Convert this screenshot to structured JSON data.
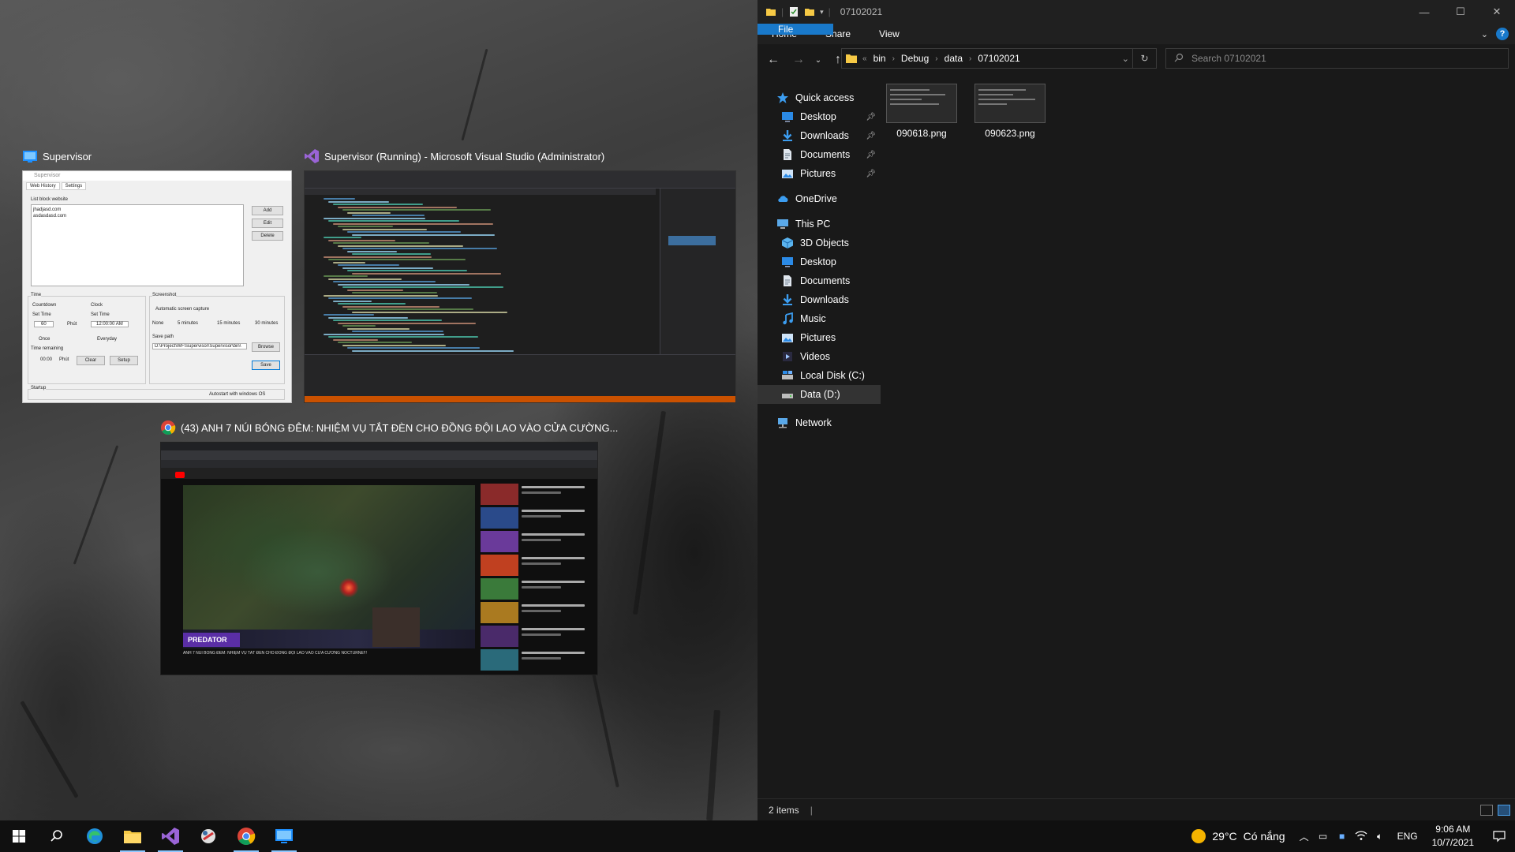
{
  "taskview": {
    "supervisor": {
      "title": "Supervisor",
      "window_title": "Supervisor",
      "tabs": [
        "Web History",
        "Settings"
      ],
      "list_label": "List block website",
      "list_items": [
        "jhadjasd.com",
        "asdasdasd.com"
      ],
      "buttons": {
        "add": "Add",
        "edit": "Edit",
        "delete": "Delete",
        "clear": "Clear",
        "setup": "Setup",
        "save": "Save",
        "browse": "Browse"
      },
      "time_group": "Time",
      "countdown": "Countdown",
      "clock": "Clock",
      "set_time": "Set Time",
      "set_time_value": "60",
      "unit": "Phút",
      "clock_value": "12:00:00 AM",
      "once": "Once",
      "everyday": "Everyday",
      "time_remaining": "Time remaining",
      "remaining_value": "00:00",
      "remaining_unit": "Phút",
      "screenshot_group": "Screenshot",
      "auto_capture": "Automatic screen capture",
      "radio_none": "None",
      "radio_5": "5 minutes",
      "radio_15": "15 minutes",
      "radio_30": "30 minutes",
      "save_path": "Save path",
      "save_path_value": "D:\\Project\\WF\\Supervisor\\Supervisor\\bin\\",
      "startup_group": "Startup",
      "autostart": "Autostart with windows OS"
    },
    "vs": {
      "title": "Supervisor (Running) - Microsoft Visual Studio (Administrator)"
    },
    "chrome": {
      "title": "(43) ANH 7 NÚI BÓNG ĐÊM: NHIỆM VỤ TẮT ĐÈN CHO ĐỒNG ĐỘI LAO VÀO CỬA CƯỜNG...",
      "video_caption": "ANH 7 NÚI BÓNG ĐÊM: NHIỆM VỤ TẮT ĐÈN CHO ĐỒNG ĐỘI LAO VÀO CỬA CƯỜNG NOCTURNE!!!",
      "brand": "PREDATOR"
    }
  },
  "explorer": {
    "title": "07102021",
    "ribbon": [
      "File",
      "Home",
      "Share",
      "View"
    ],
    "breadcrumb": [
      "bin",
      "Debug",
      "data",
      "07102021"
    ],
    "search_placeholder": "Search 07102021",
    "nav": {
      "quick_access": "Quick access",
      "qa_items": [
        "Desktop",
        "Downloads",
        "Documents",
        "Pictures"
      ],
      "onedrive": "OneDrive",
      "this_pc": "This PC",
      "pc_items": [
        "3D Objects",
        "Desktop",
        "Documents",
        "Downloads",
        "Music",
        "Pictures",
        "Videos",
        "Local Disk (C:)",
        "Data (D:)"
      ],
      "network": "Network"
    },
    "files": [
      "090618.png",
      "090623.png"
    ],
    "status": "2 items"
  },
  "taskbar": {
    "weather_temp": "29°C",
    "weather_text": "Có nắng",
    "lang": "ENG",
    "time": "9:06 AM",
    "date": "10/7/2021"
  },
  "colors": {
    "accent": "#1979ca",
    "vs_status": "#ca5100",
    "explorer_bg": "#191919"
  }
}
